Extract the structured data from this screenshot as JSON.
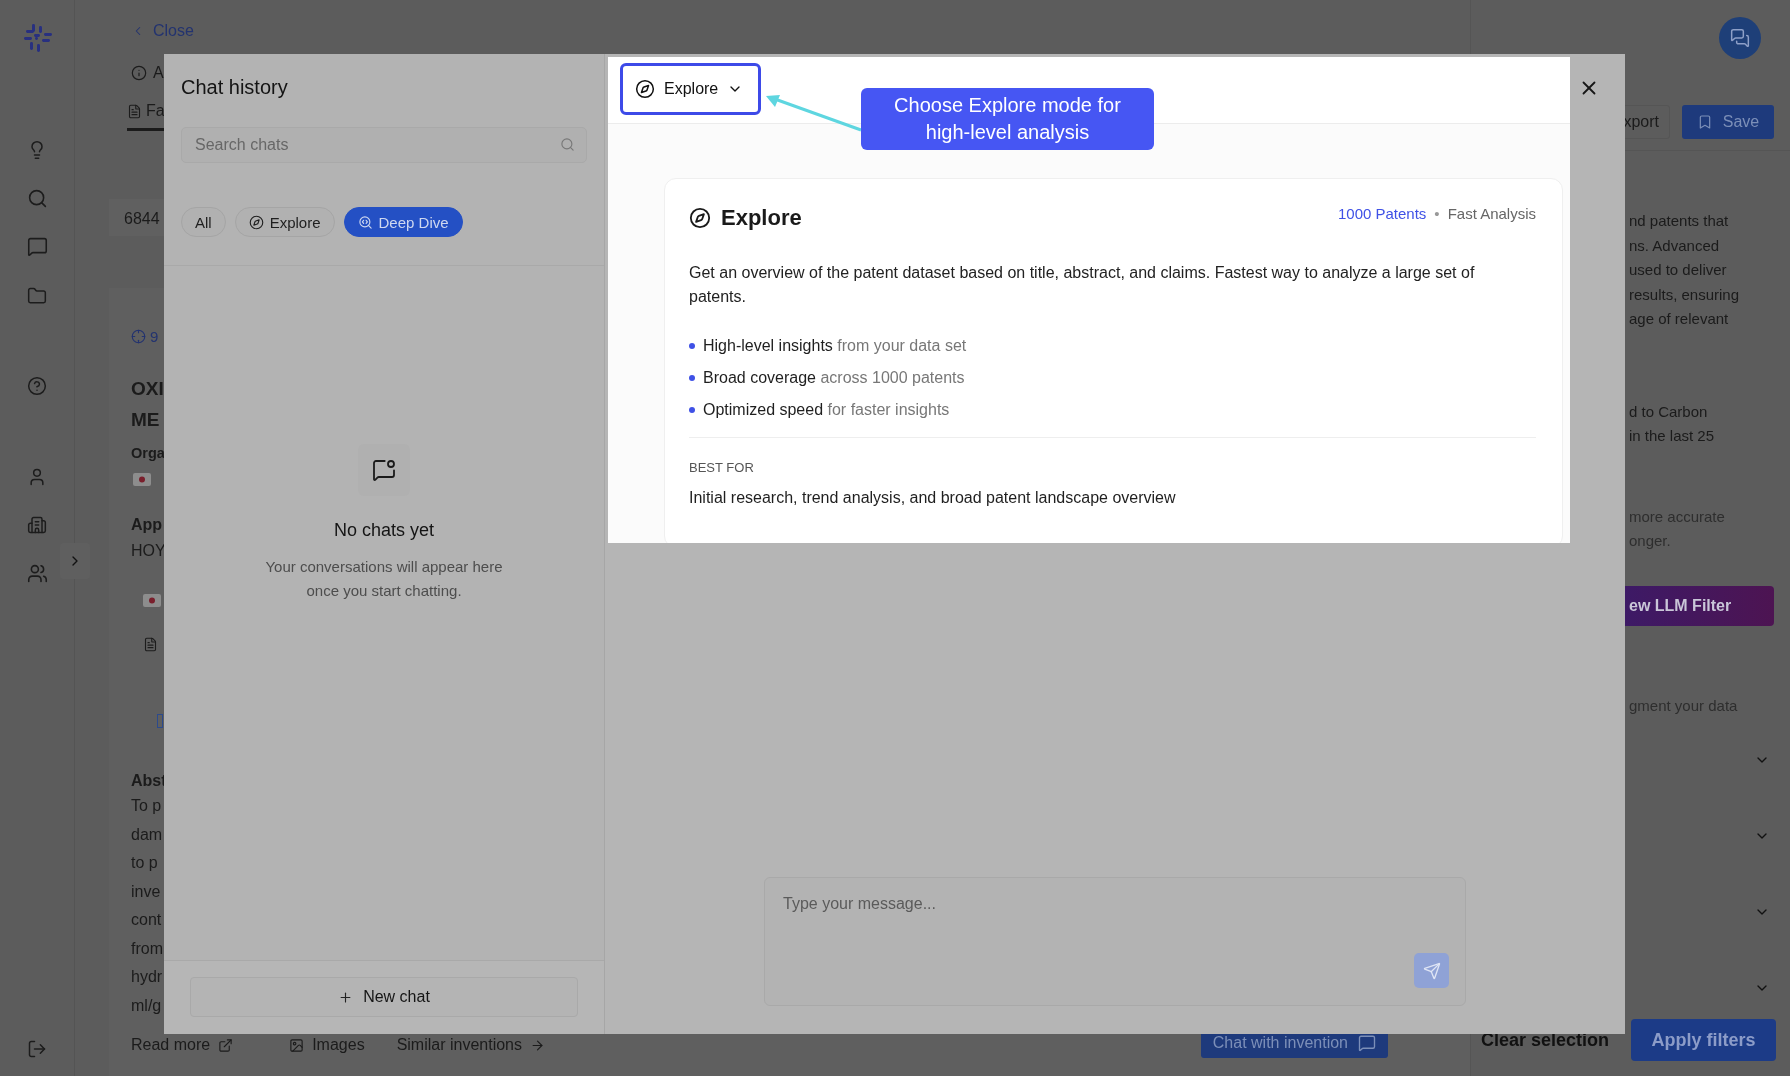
{
  "background_page": {
    "back_link": "Close",
    "info_label": "A",
    "tab": {
      "label": "Fa",
      "selected": true
    },
    "count": "6844",
    "result": {
      "badge": "9",
      "title_lines": [
        "OXI",
        "ME"
      ],
      "org_label": "Orga",
      "applicant_label": "App",
      "applicant": "HOY",
      "abstract_label": "Abst",
      "abstract_lines": [
        "To p",
        "dam",
        "to p",
        "inve",
        "cont",
        "from",
        "hydr",
        "ml/g"
      ]
    },
    "result_actions": [
      {
        "label": "Read more",
        "kind": "external"
      },
      {
        "label": "Images",
        "kind": "images"
      },
      {
        "label": "Similar inventions",
        "kind": "similar"
      }
    ],
    "chat_with_invention": "Chat with invention",
    "right_panel": {
      "export": "xport",
      "save": "Save",
      "text_blocks": [
        [
          "nd patents that",
          "ns. Advanced",
          "used to deliver",
          "results, ensuring",
          "age of relevant"
        ],
        [
          "d to Carbon",
          "in the last 25"
        ],
        [
          "more accurate",
          "onger."
        ]
      ],
      "llm_filter": "ew LLM Filter",
      "augment_text": "gment your data",
      "clear_selection": "Clear selection",
      "apply_filters": "Apply filters"
    }
  },
  "chat_modal": {
    "history": {
      "title": "Chat history",
      "search_placeholder": "Search chats",
      "filters": [
        {
          "label": "All",
          "kind": "all",
          "selected": false
        },
        {
          "label": "Explore",
          "kind": "explore",
          "selected": false
        },
        {
          "label": "Deep Dive",
          "kind": "deep_dive",
          "selected": true
        }
      ],
      "empty_title": "No chats yet",
      "empty_text": "Your conversations will appear here once you start chatting.",
      "new_chat": "New chat"
    },
    "mode_selector": {
      "label": "Explore"
    },
    "mode_card": {
      "title": "Explore",
      "patents": "1000 Patents",
      "separator": "•",
      "speed": "Fast Analysis",
      "description": "Get an overview of the patent dataset based on title, abstract, and claims. Fastest way to analyze a large set of patents.",
      "features": [
        {
          "highlight": "High-level insights",
          "rest": "from your data set"
        },
        {
          "highlight": "Broad coverage",
          "rest": "across 1000 patents"
        },
        {
          "highlight": "Optimized speed",
          "rest": "for faster insights"
        }
      ],
      "best_for_label": "BEST FOR",
      "best_for": "Initial research, trend analysis, and broad patent landscape overview"
    },
    "composer": {
      "placeholder": "Type your message..."
    }
  },
  "tutorial": {
    "callout": "Choose Explore mode for high-level analysis"
  }
}
